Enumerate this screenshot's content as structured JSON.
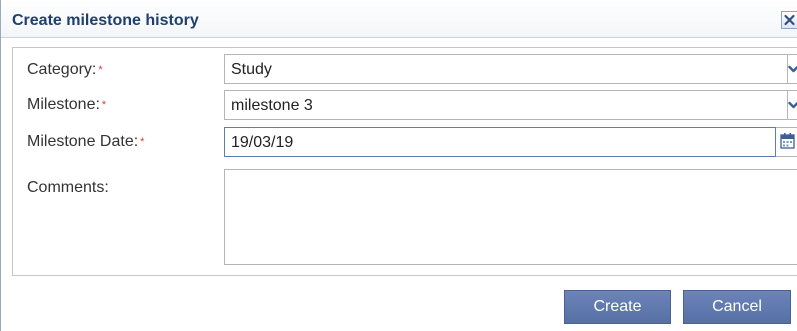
{
  "dialog": {
    "title": "Create milestone history",
    "close_icon": "close-icon"
  },
  "form": {
    "category": {
      "label": "Category:",
      "required_marker": "*",
      "value": "Study",
      "icon": "chevron-down-icon"
    },
    "milestone": {
      "label": "Milestone:",
      "required_marker": "*",
      "value": "milestone 3",
      "icon": "chevron-down-icon"
    },
    "milestone_date": {
      "label": "Milestone Date:",
      "required_marker": "*",
      "value": "19/03/19",
      "icon": "calendar-icon"
    },
    "comments": {
      "label": "Comments:",
      "value": ""
    }
  },
  "buttons": {
    "create_label": "Create",
    "cancel_label": "Cancel"
  },
  "colors": {
    "title_text": "#1f3f6f",
    "required_marker": "#d93a3a",
    "button_bg": "#6079ad",
    "icon_blue": "#3b5f99"
  }
}
